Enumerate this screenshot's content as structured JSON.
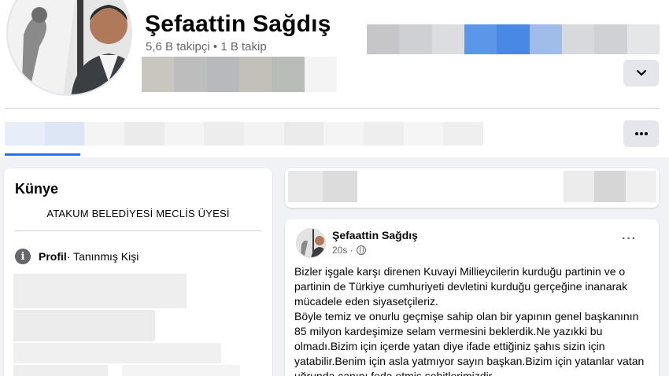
{
  "profile": {
    "name": "Şefaattin Sağdış",
    "followers": "5,6 B takipçi",
    "separator": " • ",
    "following": "1 B takip"
  },
  "buttons": {
    "chevron_icon": "chevron-down-icon",
    "more_icon": "more-dots-icon"
  },
  "intro": {
    "title": "Künye",
    "bio": "ATAKUM BELEDİYESİ MECLİS ÜYESİ",
    "profile_label": "Profil",
    "profile_rest": " · Tanınmış Kişi"
  },
  "post": {
    "author": "Şefaattin Sağdış",
    "time": "20s ·",
    "menu": "···",
    "paragraphs": [
      "Bizler işgale karşı direnen Kuvayi Millieycilerin kurduğu partinin ve o partinin de Türkiye cumhuriyeti devletini kurduğu gerçeğine inanarak mücadele eden siyasetçileriz.",
      "Böyle temiz ve onurlu geçmişe sahip olan bir yapının genel başkanının 85 milyon kardeşimize selam vermesini beklerdik.Ne yazıkki bu olmadı.Bizim için içerde yatan diye ifade ettiğiniz şahıs sizin için yatabilir.Benim için asla yatmıyor sayın başkan.Bizim için yatanlar vatan uğrunda canını feda etmiş şehitlerimizdir."
    ]
  },
  "colors": {
    "accent": "#1877f2",
    "secondary_text": "#65676b",
    "page_bg": "#f0f2f5"
  }
}
